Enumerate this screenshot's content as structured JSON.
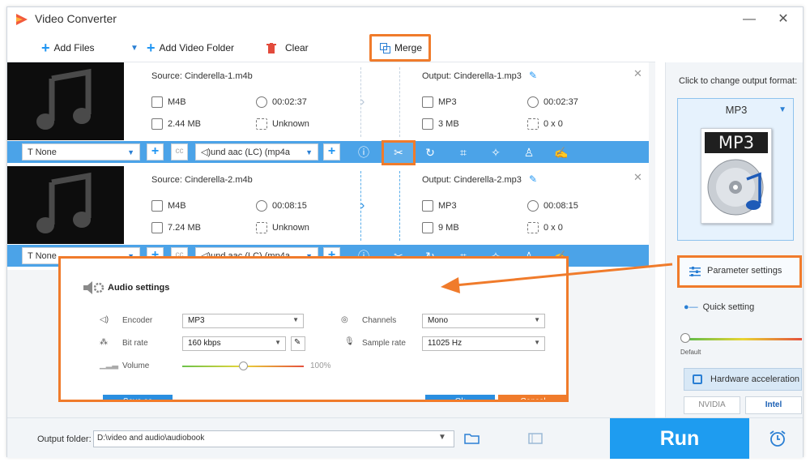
{
  "app": {
    "title": "Video Converter"
  },
  "toolbar": {
    "add_files": "Add Files",
    "add_video_folder": "Add Video Folder",
    "clear": "Clear",
    "merge": "Merge"
  },
  "files": [
    {
      "source": "Source: Cinderella-1.m4b",
      "src_format": "M4B",
      "src_duration": "00:02:37",
      "src_size": "2.44 MB",
      "src_resolution": "Unknown",
      "output": "Output: Cinderella-1.mp3",
      "out_format": "MP3",
      "out_duration": "00:02:37",
      "out_size": "3 MB",
      "out_resolution": "0 x 0",
      "subtitle": "None",
      "audio_track": "und aac (LC) (mp4a"
    },
    {
      "source": "Source: Cinderella-2.m4b",
      "src_format": "M4B",
      "src_duration": "00:08:15",
      "src_size": "7.24 MB",
      "src_resolution": "Unknown",
      "output": "Output: Cinderella-2.mp3",
      "out_format": "MP3",
      "out_duration": "00:08:15",
      "out_size": "9 MB",
      "out_resolution": "0 x 0",
      "subtitle": "None",
      "audio_track": "und aac (LC) (mp4a"
    }
  ],
  "sidebar": {
    "caption": "Click to change output format:",
    "format": "MP3",
    "format_tile": "MP3",
    "parameter_settings": "Parameter settings",
    "quick_setting": "Quick setting",
    "default": "Default",
    "hardware_acceleration": "Hardware acceleration",
    "nvidia": "NVIDIA",
    "intel": "Intel"
  },
  "audio_settings": {
    "title": "Audio settings",
    "encoder_label": "Encoder",
    "encoder": "MP3",
    "channels_label": "Channels",
    "channels": "Mono",
    "bitrate_label": "Bit rate",
    "bitrate": "160 kbps",
    "samplerate_label": "Sample rate",
    "samplerate": "11025 Hz",
    "volume_label": "Volume",
    "volume": "100%",
    "volume_level": 0.5,
    "save_as": "Save as",
    "ok": "Ok",
    "cancel": "Cancel"
  },
  "bottom": {
    "output_folder_label": "Output folder:",
    "output_folder": "D:\\video and audio\\audiobook",
    "run": "Run"
  },
  "colors": {
    "accent": "#1e9cf0",
    "highlight": "#f07b2b",
    "strip": "#4ba3e8"
  }
}
